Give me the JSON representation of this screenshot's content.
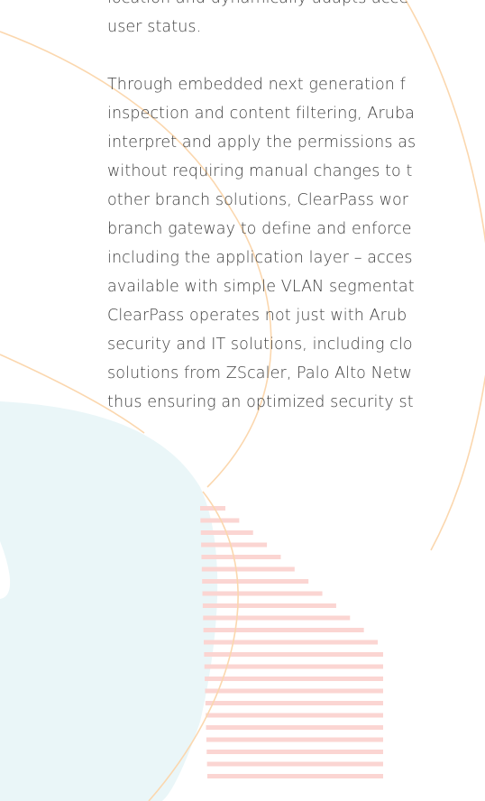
{
  "paragraph_end": [
    "location and dynamically adapts acce",
    "user status."
  ],
  "paragraph_main": [
    "Through embedded next generation f",
    "inspection and content filtering, Aruba",
    "interpret and apply the permissions as",
    "without requiring manual changes to t",
    "other branch solutions, ClearPass wor",
    "branch gateway to define and enforce",
    "including the application layer – acces",
    "available with simple VLAN segmentat",
    "ClearPass operates not just with Arub",
    "security and IT solutions, including clo",
    "solutions from ZScaler, Palo Alto Netw",
    "thus ensuring an optimized security st"
  ],
  "colors": {
    "text": "#3f3f3f",
    "arc_orange": "#fbd7ae",
    "blob_light_blue": "#eaf6f8",
    "stripe_pink": "#fbd5d2"
  }
}
